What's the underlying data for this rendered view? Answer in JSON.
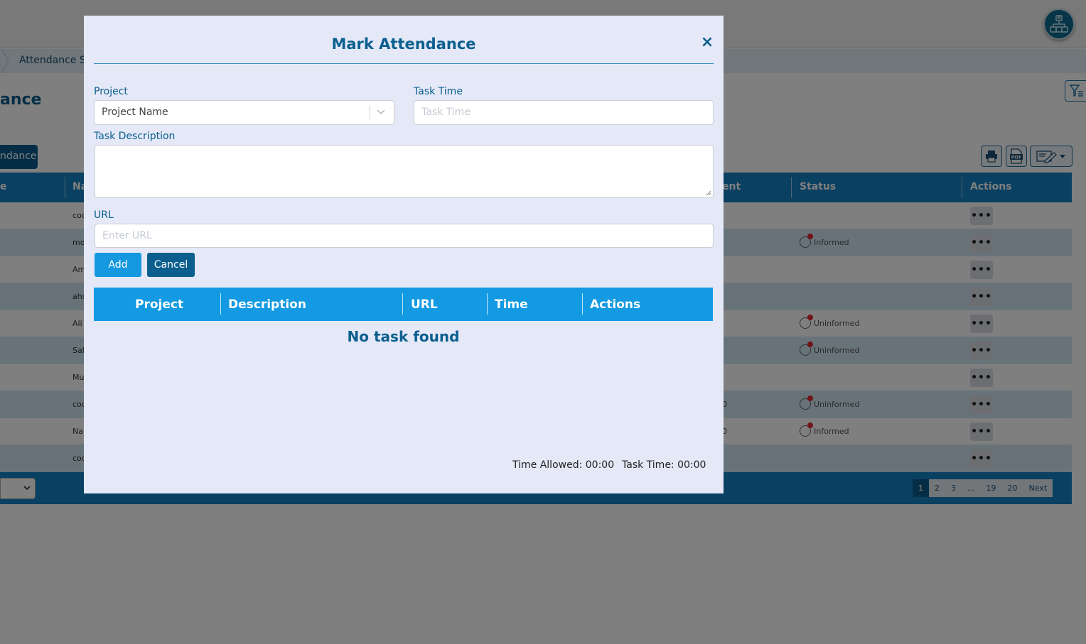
{
  "background": {
    "breadcrumb": "Attendance Sy",
    "page_title": "ance",
    "mark_button": "ndance",
    "grid": {
      "headers": [
        "e",
        "Na",
        "ent",
        "Status",
        "Actions"
      ],
      "rows": [
        {
          "name": "coc",
          "mid": "",
          "status": ""
        },
        {
          "name": "mo",
          "mid": "",
          "status": "Informed"
        },
        {
          "name": "Am",
          "mid": "",
          "status": ""
        },
        {
          "name": "ahs",
          "mid": "",
          "status": ""
        },
        {
          "name": "Ali",
          "mid": "",
          "status": "Uninformed"
        },
        {
          "name": "Sal",
          "mid": "",
          "status": "Uninformed"
        },
        {
          "name": "Mu",
          "mid": "",
          "status": ""
        },
        {
          "name": "coc",
          "mid": "0",
          "status": "Uninformed"
        },
        {
          "name": "Na",
          "mid": "0",
          "status": "Informed"
        },
        {
          "name": "coc",
          "mid": "",
          "status": ""
        }
      ],
      "row_action": "•••"
    },
    "pager": [
      "1",
      "2",
      "3",
      "...",
      "19",
      "20",
      "Next"
    ],
    "pager_active": "1"
  },
  "modal": {
    "title": "Mark Attendance",
    "close": "×",
    "project_label": "Project",
    "project_placeholder": "Project Name",
    "task_time_label": "Task Time",
    "task_time_placeholder": "Task Time",
    "task_description_label": "Task Description",
    "task_description_value": "",
    "url_label": "URL",
    "url_placeholder": "Enter URL",
    "add_button": "Add",
    "cancel_button": "Cancel",
    "table_headers": [
      "Project",
      "Description",
      "URL",
      "Time",
      "Actions"
    ],
    "empty_message": "No task found",
    "time_allowed": "Time Allowed: 00:00",
    "task_time_total": "Task Time: 00:00"
  },
  "colors": {
    "primary": "#0b5f8e",
    "accent": "#139ae2",
    "modal_bg": "#e4e8f7",
    "status_alert": "#e3262f"
  }
}
